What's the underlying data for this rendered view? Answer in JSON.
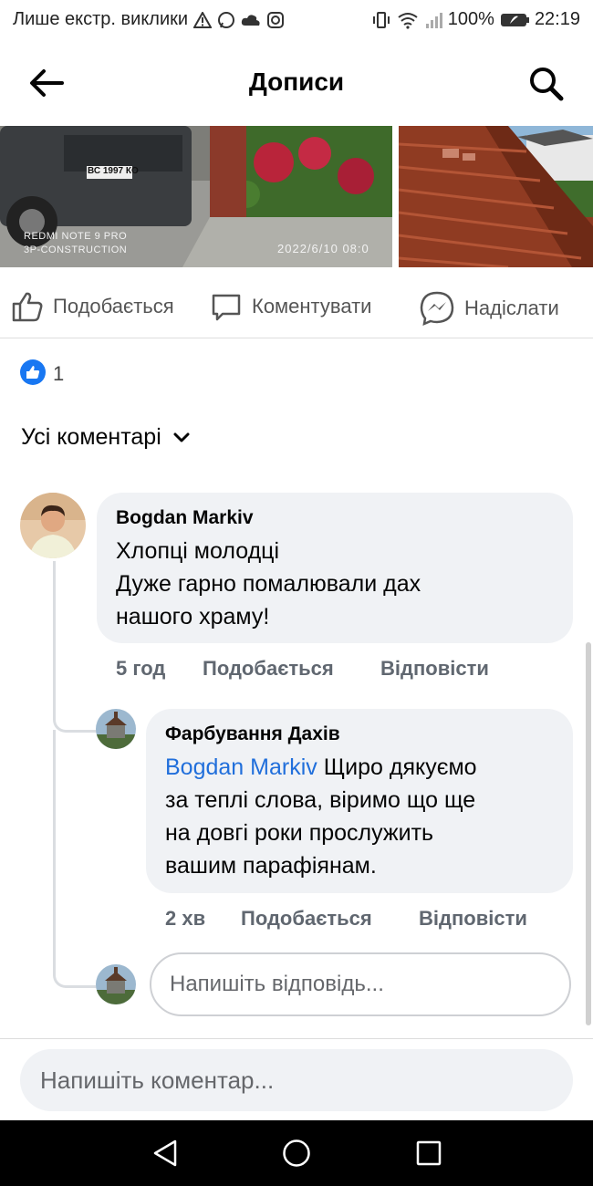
{
  "status_bar": {
    "carrier_text": "Лише екстр. виклики",
    "battery_percent": "100%",
    "time": "22:19"
  },
  "header": {
    "title": "Дописи"
  },
  "photos": {
    "photo1_watermark_device": "REDMI NOTE 9 PRO",
    "photo1_watermark_brand": "3P-CONSTRUCTION",
    "photo1_timestamp": "2022/6/10 08:0",
    "photo1_plate": "ВС 1997 КО"
  },
  "actions": {
    "like": "Подобається",
    "comment": "Коментувати",
    "send": "Надіслати"
  },
  "reactions": {
    "count": "1"
  },
  "comments_filter": {
    "label": "Усі коментарі"
  },
  "comments": [
    {
      "author": "Bogdan Markiv",
      "lines": [
        "Хлопці молодці",
        "Дуже гарно помалювали дах",
        "нашого храму!"
      ],
      "time": "5 год",
      "like_label": "Подобається",
      "reply_label": "Відповісти"
    }
  ],
  "reply": {
    "author": "Фарбування Дахів",
    "mention": "Bogdan Markiv",
    "line1_rest": " Щиро дякуємо",
    "lines": [
      "за теплі слова, віримо що ще",
      "на довгі роки прослужить",
      "вашим парафіянам."
    ],
    "time": "2 хв",
    "like_label": "Подобається",
    "reply_label": "Відповісти"
  },
  "reply_input": {
    "placeholder": "Напишіть відповідь..."
  },
  "comment_input": {
    "placeholder": "Напишіть коментар..."
  },
  "colors": {
    "accent": "#1877f2",
    "bubble": "#f0f2f5",
    "meta": "#606770"
  }
}
